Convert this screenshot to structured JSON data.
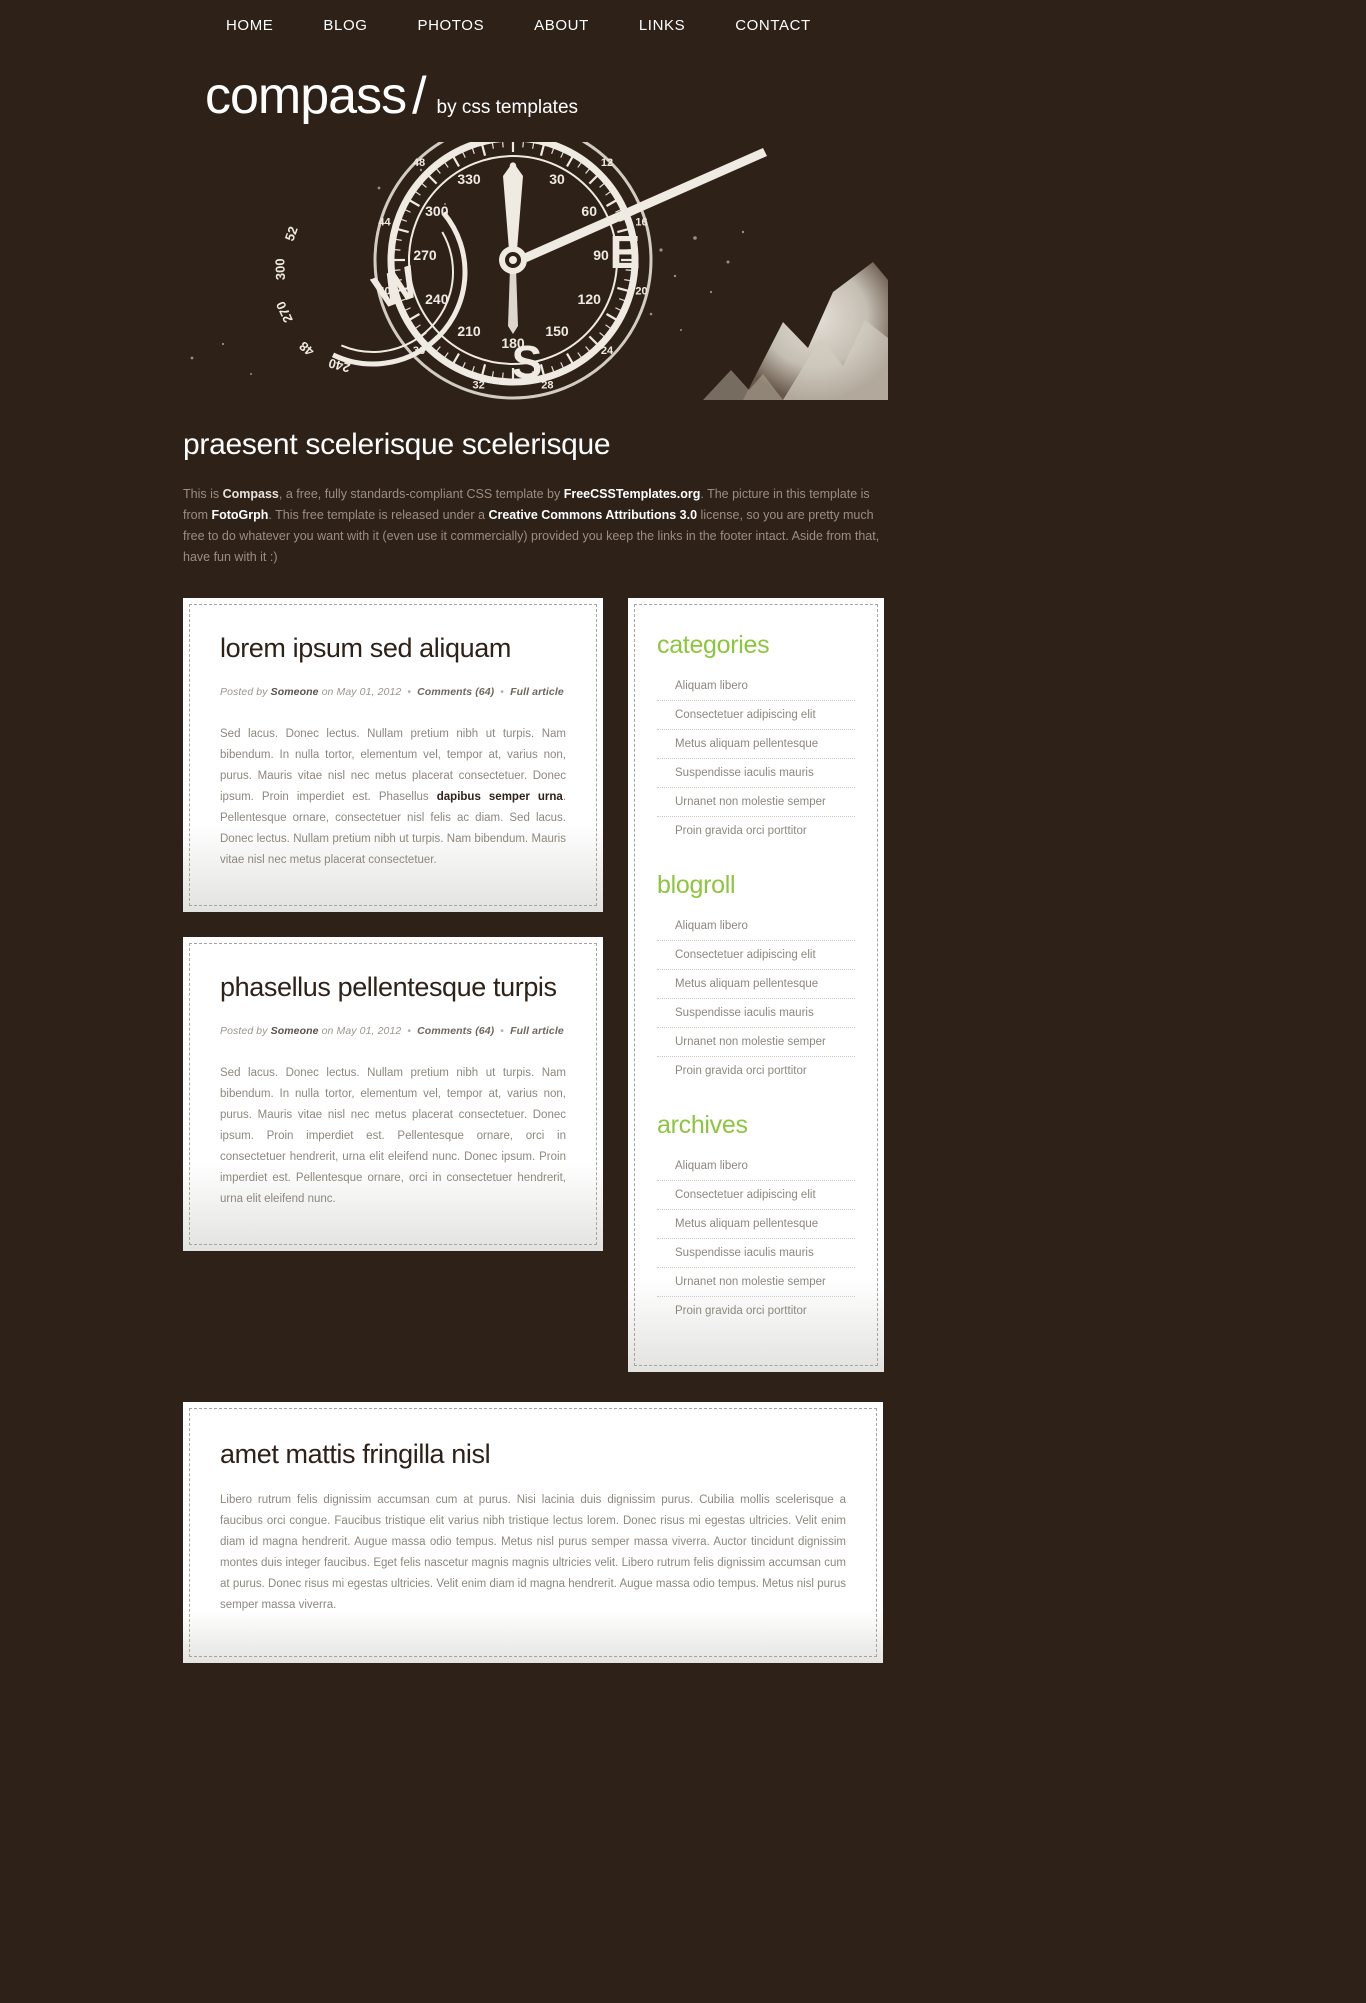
{
  "nav": {
    "items": [
      {
        "label": "HOME"
      },
      {
        "label": "BLOG"
      },
      {
        "label": "PHOTOS"
      },
      {
        "label": "ABOUT"
      },
      {
        "label": "LINKS"
      },
      {
        "label": "CONTACT"
      }
    ]
  },
  "logo": {
    "name": "compass",
    "slash": "/",
    "tagline": "by css templates"
  },
  "banner": {
    "alt": "compass-photo"
  },
  "intro": {
    "heading": "praesent scelerisque scelerisque",
    "text_1": "This is ",
    "brand": "Compass",
    "text_2": ", a free, fully standards-compliant CSS template by ",
    "link_1": "FreeCSSTemplates.org",
    "text_3": ". The picture in this template is from ",
    "link_2": "FotoGrph",
    "text_4": ". This free template is released under a ",
    "link_3": "Creative Commons Attributions 3.0",
    "text_5": " license, so you are pretty much free to do whatever you want with it (even use it commercially) provided you keep the links in the footer intact. Aside from that, have fun with it :)"
  },
  "posts": [
    {
      "title": "lorem ipsum sed aliquam",
      "meta_posted": "Posted by ",
      "meta_author": "Someone",
      "meta_on": " on May 01, 2012",
      "meta_comments": "Comments (64)",
      "meta_full": "Full article",
      "separator": "•",
      "body_1": "Sed lacus. Donec lectus. Nullam pretium nibh ut turpis. Nam bibendum. In nulla tortor, elementum vel, tempor at, varius non, purus. Mauris vitae nisl nec metus placerat consectetuer. Donec ipsum. Proin imperdiet est. Phasellus ",
      "body_bold": "dapibus semper urna",
      "body_2": ". Pellentesque ornare, consectetuer nisl felis ac diam. Sed lacus. Donec lectus. Nullam pretium nibh ut turpis. Nam bibendum. Mauris vitae nisl nec metus placerat consectetuer."
    },
    {
      "title": "phasellus pellentesque turpis",
      "meta_posted": "Posted by ",
      "meta_author": "Someone",
      "meta_on": " on May 01, 2012",
      "meta_comments": "Comments (64)",
      "meta_full": "Full article",
      "separator": "•",
      "body_1": "Sed lacus. Donec lectus. Nullam pretium nibh ut turpis. Nam bibendum. In nulla tortor, elementum vel, tempor at, varius non, purus. Mauris vitae nisl nec metus placerat consectetuer. Donec ipsum. Proin imperdiet est. Pellentesque ornare, orci in consectetuer hendrerit, urna elit eleifend nunc. Donec ipsum. Proin imperdiet est. Pellentesque ornare, orci in consectetuer hendrerit, urna elit eleifend nunc.",
      "body_bold": "",
      "body_2": ""
    }
  ],
  "sidebar": {
    "sections": [
      {
        "title": "categories",
        "items": [
          "Aliquam libero",
          "Consectetuer adipiscing elit",
          "Metus aliquam pellentesque",
          "Suspendisse iaculis mauris",
          "Urnanet non molestie semper",
          "Proin gravida orci porttitor"
        ]
      },
      {
        "title": "blogroll",
        "items": [
          "Aliquam libero",
          "Consectetuer adipiscing elit",
          "Metus aliquam pellentesque",
          "Suspendisse iaculis mauris",
          "Urnanet non molestie semper",
          "Proin gravida orci porttitor"
        ]
      },
      {
        "title": "archives",
        "items": [
          "Aliquam libero",
          "Consectetuer adipiscing elit",
          "Metus aliquam pellentesque",
          "Suspendisse iaculis mauris",
          "Urnanet non molestie semper",
          "Proin gravida orci porttitor"
        ]
      }
    ]
  },
  "bottom": {
    "title": "amet mattis fringilla nisl",
    "body": "Libero rutrum felis dignissim accumsan cum at purus. Nisi lacinia duis dignissim purus. Cubilia mollis scelerisque a faucibus orci congue. Faucibus tristique elit varius nibh tristique lectus lorem. Donec risus mi egestas ultricies. Velit enim diam id magna hendrerit. Augue massa odio tempus. Metus nisl purus semper massa viverra. Auctor tincidunt dignissim montes duis integer faucibus. Eget felis nascetur magnis magnis ultricies velit. Libero rutrum felis dignissim accumsan cum at purus. Donec risus mi egestas ultricies. Velit enim diam id magna hendrerit. Augue massa odio tempus. Metus nisl purus semper massa viverra."
  },
  "colors": {
    "background": "#2e2118",
    "accent_green": "#8cc63e",
    "panel": "#ffffff",
    "body_text": "#8d887e",
    "intro_text": "#9b8d82"
  }
}
